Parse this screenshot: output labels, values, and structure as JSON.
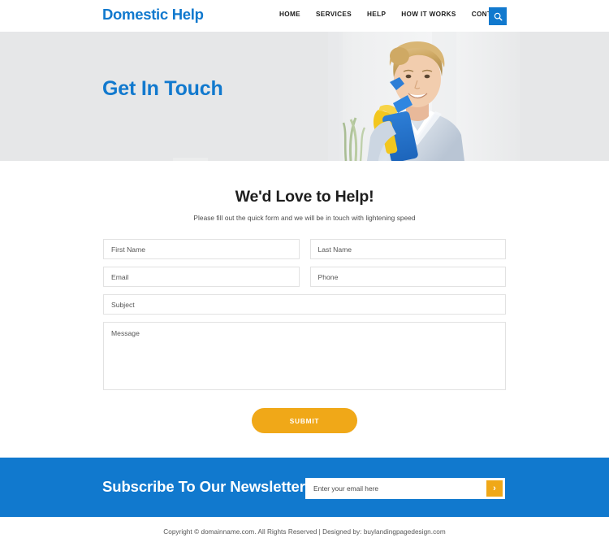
{
  "header": {
    "logo": "Domestic Help",
    "nav": [
      {
        "label": "HOME"
      },
      {
        "label": "SERVICES"
      },
      {
        "label": "HELP"
      },
      {
        "label": "HOW IT WORKS"
      },
      {
        "label": "CONTACT"
      }
    ],
    "search_icon": "search-icon",
    "accent_color": "#1179ce"
  },
  "hero": {
    "title": "Get In Touch",
    "background_color": "#e6e7e8",
    "title_color": "#1179ce",
    "photo_alt": "smiling cleaning professional holding a spray bottle"
  },
  "form_section": {
    "heading": "We'd Love to Help!",
    "subheading": "Please fill out the quick form and we will be in touch with lightening speed",
    "fields": {
      "first_name": {
        "placeholder": "First Name",
        "value": ""
      },
      "last_name": {
        "placeholder": "Last Name",
        "value": ""
      },
      "email": {
        "placeholder": "Email",
        "value": ""
      },
      "phone": {
        "placeholder": "Phone",
        "value": ""
      },
      "subject": {
        "placeholder": "Subject",
        "value": ""
      },
      "message": {
        "placeholder": "Message",
        "value": ""
      }
    },
    "submit_label": "SUBMIT",
    "submit_color": "#f0a818"
  },
  "newsletter": {
    "title": "Subscribe To Our Newsletter",
    "input_placeholder": "Enter your email here",
    "input_value": "",
    "submit_glyph": "›",
    "background_color": "#1179ce",
    "button_color": "#f0a818"
  },
  "footer": {
    "copyright": "Copyright © domainname.com. All Rights Reserved  |  Designed by: buylandingpagedesign.com"
  }
}
